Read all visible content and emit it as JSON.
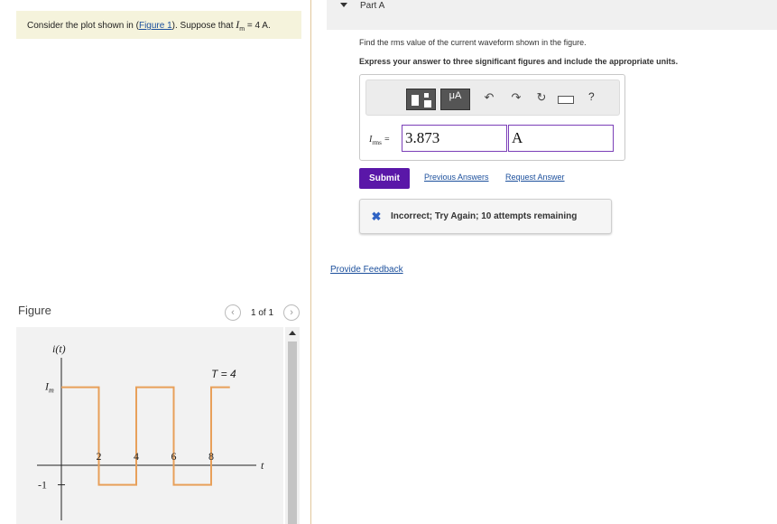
{
  "problem": {
    "prefix": "Consider the plot shown in (",
    "figure_link": "Figure 1",
    "middle": "). Suppose that ",
    "var": "I",
    "var_sub": "m",
    "suffix": " = 4 A."
  },
  "figure_panel": {
    "label": "Figure",
    "pager_count": "1 of 1",
    "prev_icon": "chevron-left-icon",
    "next_icon": "chevron-right-icon"
  },
  "part": {
    "title": "Part A",
    "question": "Find the rms value of the current waveform shown in the figure.",
    "instructions": "Express your answer to three significant figures and include the appropriate units."
  },
  "toolbar": {
    "units_label": "μA",
    "icons": [
      "templates-icon",
      "units-icon",
      "undo-icon",
      "redo-icon",
      "reset-icon",
      "keyboard-icon",
      "help-icon"
    ],
    "help_label": "?"
  },
  "answer": {
    "label_var": "I",
    "label_sub": "rms",
    "label_eq": " =",
    "value": "3.873",
    "unit": "A"
  },
  "actions": {
    "submit": "Submit",
    "previous_answers": "Previous Answers",
    "request_answer": "Request Answer"
  },
  "feedback": {
    "icon": "x-icon",
    "text": "Incorrect; Try Again; 10 attempts remaining"
  },
  "provide_feedback": "Provide Feedback",
  "colors": {
    "problem_bg": "#f5f3dc",
    "submit_bg": "#5a17a8",
    "link": "#1b4f9c",
    "input_border": "#7b3fb8",
    "waveform": "#e8a05a"
  },
  "chart_data": {
    "type": "line",
    "title": "",
    "ylabel": "i(t)",
    "xlabel": "t",
    "period_label": "T = 4",
    "y_tick_labels": [
      "I_m",
      "-1"
    ],
    "x_tick_labels": [
      "2",
      "4",
      "6",
      "8"
    ],
    "series": [
      {
        "x": [
          0,
          2,
          2,
          4,
          4,
          6,
          6,
          8,
          8,
          9
        ],
        "y": [
          4,
          4,
          -1,
          -1,
          4,
          4,
          -1,
          -1,
          4,
          4
        ]
      }
    ],
    "grid": false
  }
}
